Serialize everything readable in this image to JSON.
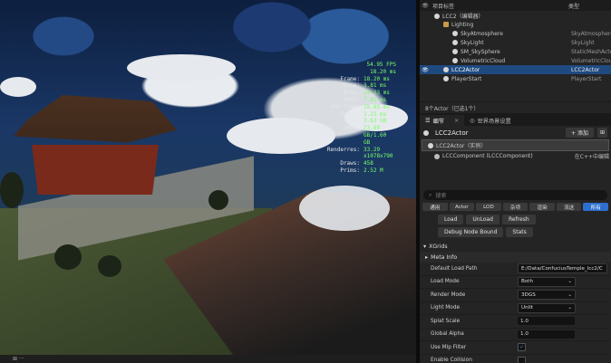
{
  "stats": [
    {
      "label": "",
      "value": "54.95 FPS",
      "fps": true
    },
    {
      "label": "",
      "value": "18.20 ms",
      "fps": true
    },
    {
      "label": "Frame:",
      "value": "18.20 ms"
    },
    {
      "label": "Game:",
      "value": "3.81 ms"
    },
    {
      "label": "Draw:",
      "value": "14.23 ms"
    },
    {
      "label": "RHIT:",
      "value": "7.81 ms"
    },
    {
      "label": "GPU Time:",
      "value": "15.85 ms"
    },
    {
      "label": "Input:",
      "value": "1.22 ms"
    },
    {
      "label": "Mem:",
      "value": "3.63 GB"
    },
    {
      "label": "VMem:",
      "value": "23.89 GB/1.60 GB"
    },
    {
      "label": "Renderres:",
      "value": "33.29 x1078x790"
    },
    {
      "label": "Draws:",
      "value": "458"
    },
    {
      "label": "Prims:",
      "value": "2.52 M"
    }
  ],
  "viewport_status": "⊞ ···",
  "outliner": {
    "col_label": "项目标签",
    "col_type": "类型",
    "rows": [
      {
        "label": "LCC2（编辑器）",
        "type": "",
        "indent": 0,
        "icon": "level-icon",
        "selected": false,
        "eye": ""
      },
      {
        "label": "Lighting",
        "type": "",
        "indent": 1,
        "icon": "folder-icon",
        "selected": false,
        "eye": ""
      },
      {
        "label": "SkyAtmosphere",
        "type": "SkyAtmosphere",
        "indent": 2,
        "icon": "actor-icon",
        "selected": false,
        "eye": ""
      },
      {
        "label": "SkyLight",
        "type": "SkyLight",
        "indent": 2,
        "icon": "actor-icon",
        "selected": false,
        "eye": ""
      },
      {
        "label": "SM_SkySphere",
        "type": "StaticMeshActor",
        "indent": 2,
        "icon": "actor-icon",
        "selected": false,
        "eye": ""
      },
      {
        "label": "VolumetricCloud",
        "type": "VolumetricCloud",
        "indent": 2,
        "icon": "actor-icon",
        "selected": false,
        "eye": ""
      },
      {
        "label": "LCC2Actor",
        "type": "LCC2Actor",
        "indent": 1,
        "icon": "actor-icon",
        "selected": true,
        "eye": "👁"
      },
      {
        "label": "PlayerStart",
        "type": "PlayerStart",
        "indent": 1,
        "icon": "actor-icon",
        "selected": false,
        "eye": ""
      }
    ],
    "footer": "8个Actor（已选1个）"
  },
  "tabs": [
    {
      "label": "细节",
      "active": true,
      "closable": true
    },
    {
      "label": "世界场景设置",
      "active": false,
      "closable": false
    }
  ],
  "details": {
    "actor_name": "LCC2Actor",
    "add_label": "+ 添加",
    "components": [
      {
        "label": "LCC2Actor（实例）",
        "right": "",
        "selected": true
      },
      {
        "label": "LCCComponent (LCCComponent)",
        "right": "在C++中编辑",
        "selected": false
      }
    ],
    "search_placeholder": "搜索",
    "filters": [
      "通用",
      "Actor",
      "LOD",
      "杂项",
      "渲染",
      "流送",
      "所有"
    ],
    "active_filter": "所有",
    "actions": [
      "Load",
      "UnLoad",
      "Refresh",
      "Debug Node Bound",
      "Stats"
    ],
    "section_xgrids": "XGrids",
    "section_meta": "Meta Info",
    "props": [
      {
        "label": "Default Load Path",
        "kind": "text",
        "value": "E:/Data/ConfuciusTemple_lcc2/C"
      },
      {
        "label": "Load Mode",
        "kind": "dropdown",
        "value": "Both"
      },
      {
        "label": "Render Mode",
        "kind": "dropdown",
        "value": "3DGS"
      },
      {
        "label": "Light Mode",
        "kind": "dropdown",
        "value": "Unlit"
      },
      {
        "label": "Splat Scale",
        "kind": "number",
        "value": "1.0"
      },
      {
        "label": "Global Alpha",
        "kind": "number",
        "value": "1.0"
      },
      {
        "label": "Use Mip Filter",
        "kind": "check",
        "checked": true
      },
      {
        "label": "Enable Collision",
        "kind": "check",
        "checked": false
      }
    ]
  }
}
